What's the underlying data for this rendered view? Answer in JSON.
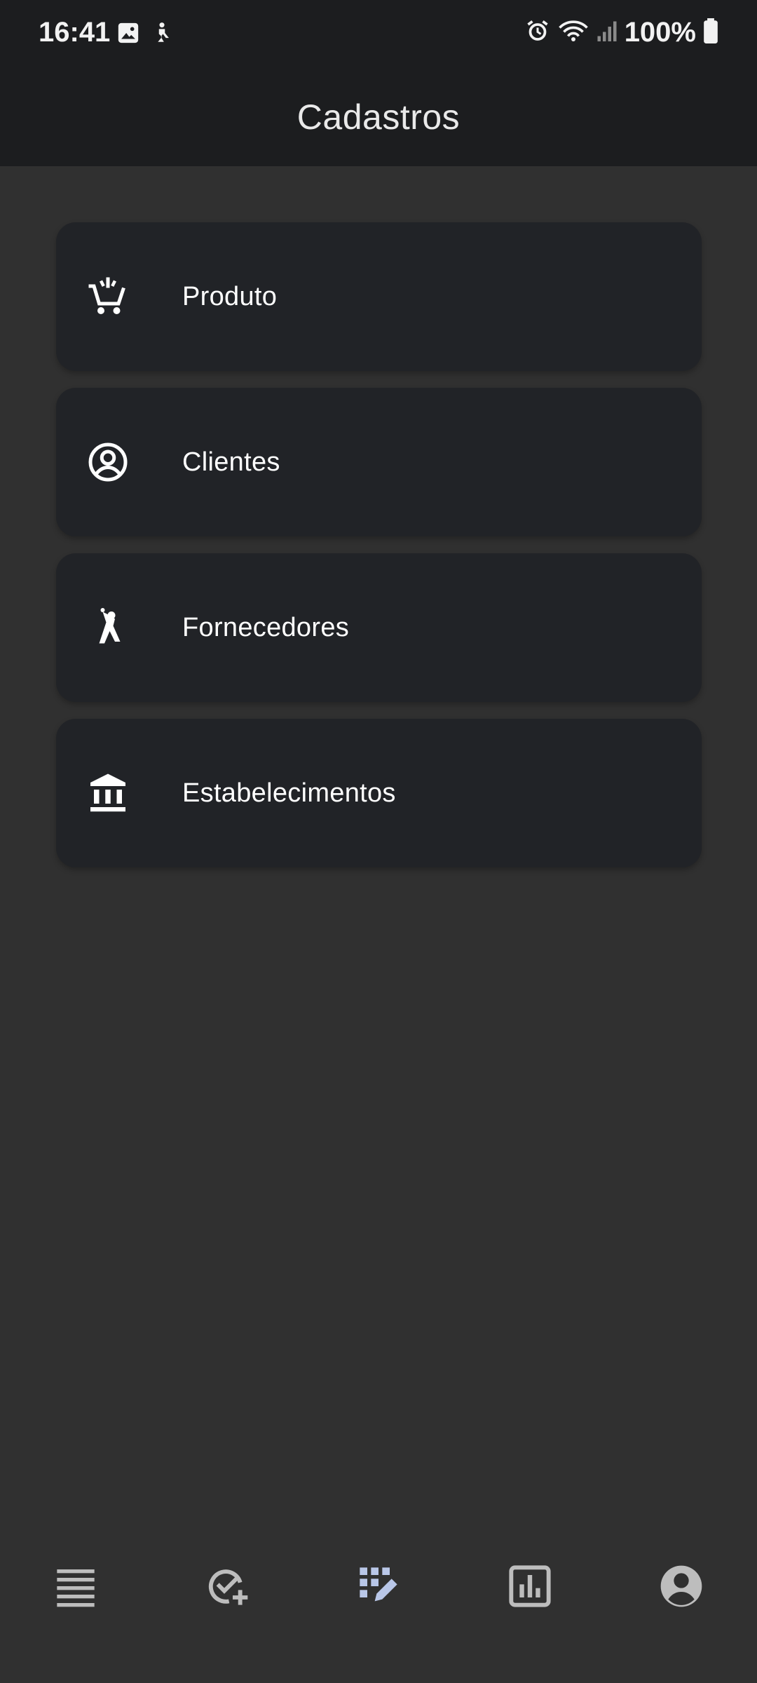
{
  "status_bar": {
    "time": "16:41",
    "battery_text": "100%",
    "icons": [
      "gallery-icon",
      "accessibility-icon",
      "alarm-icon",
      "wifi-icon",
      "signal-icon",
      "battery-icon"
    ]
  },
  "app_bar": {
    "title": "Cadastros"
  },
  "menu": [
    {
      "label": "Produto",
      "icon": "cart-icon"
    },
    {
      "label": "Clientes",
      "icon": "user-circle-icon"
    },
    {
      "label": "Fornecedores",
      "icon": "person-icon"
    },
    {
      "label": "Estabelecimentos",
      "icon": "bank-icon"
    }
  ],
  "bottom_nav": {
    "items": [
      {
        "icon": "list-icon"
      },
      {
        "icon": "check-add-icon"
      },
      {
        "icon": "grid-edit-icon",
        "active": true
      },
      {
        "icon": "chart-icon"
      },
      {
        "icon": "account-circle-icon"
      }
    ]
  },
  "colors": {
    "background": "#303030",
    "appbar": "#1c1d1f",
    "card": "#212327",
    "active_nav": "#b9c7e8",
    "inactive_nav": "#bdbdbd"
  }
}
